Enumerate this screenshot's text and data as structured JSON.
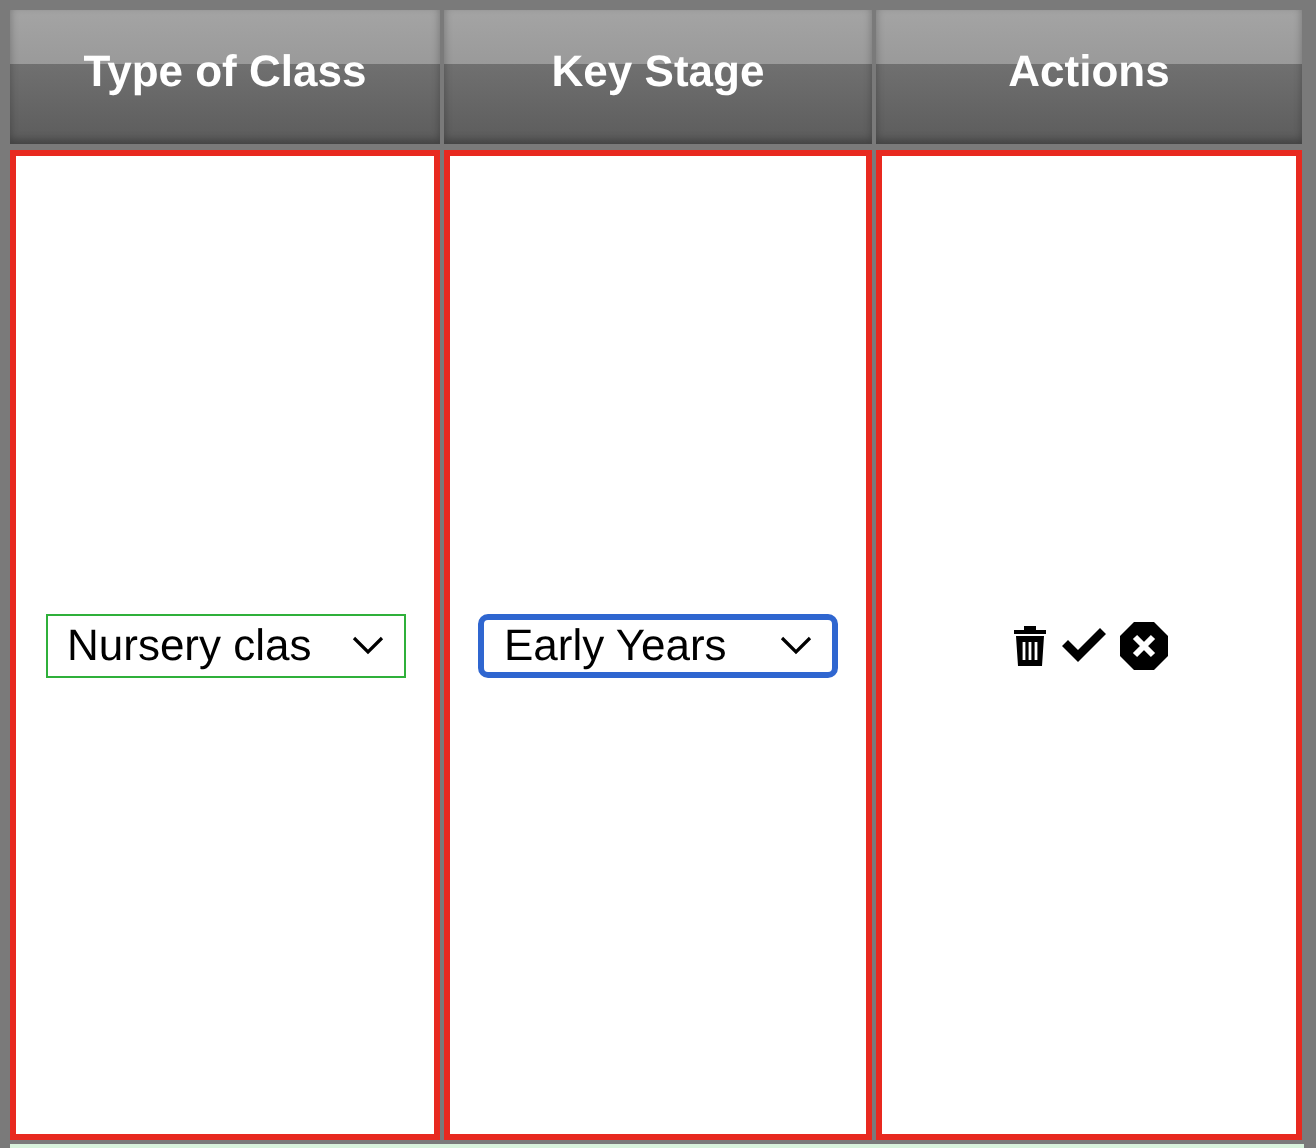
{
  "table": {
    "columns": [
      "Type of Class",
      "Key Stage",
      "Actions"
    ],
    "rows": [
      {
        "type_of_class": {
          "value": "Nursery clas",
          "focused": false
        },
        "key_stage": {
          "value": "Early Years",
          "focused": true
        },
        "actions": [
          {
            "kind": "delete"
          },
          {
            "kind": "confirm"
          },
          {
            "kind": "cancel"
          }
        ]
      }
    ]
  }
}
